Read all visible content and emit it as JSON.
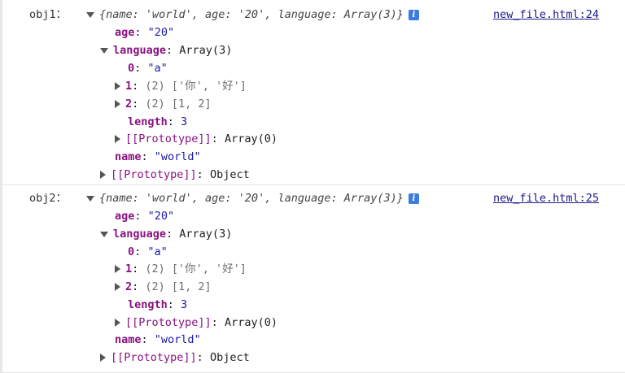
{
  "entries": [
    {
      "label": "obj1：",
      "preview": "{name: 'world', age: '20', language: Array(3)}",
      "source": "new_file.html:24",
      "age_key": "age",
      "age_val": "\"20\"",
      "lang_key": "language",
      "lang_val": "Array(3)",
      "idx0_key": "0",
      "idx0_val": "\"a\"",
      "idx1_key": "1",
      "idx1_val": "(2) ['你', '好']",
      "idx2_key": "2",
      "idx2_val": "(2) [1, 2]",
      "length_key": "length",
      "length_val": "3",
      "arr_proto": "[[Prototype]]",
      "arr_proto_val": "Array(0)",
      "name_key": "name",
      "name_val": "\"world\"",
      "obj_proto": "[[Prototype]]",
      "obj_proto_val": "Object"
    },
    {
      "label": "obj2：",
      "preview": "{name: 'world', age: '20', language: Array(3)}",
      "source": "new_file.html:25",
      "age_key": "age",
      "age_val": "\"20\"",
      "lang_key": "language",
      "lang_val": "Array(3)",
      "idx0_key": "0",
      "idx0_val": "\"a\"",
      "idx1_key": "1",
      "idx1_val": "(2) ['你', '好']",
      "idx2_key": "2",
      "idx2_val": "(2) [1, 2]",
      "length_key": "length",
      "length_val": "3",
      "arr_proto": "[[Prototype]]",
      "arr_proto_val": "Array(0)",
      "name_key": "name",
      "name_val": "\"world\"",
      "obj_proto": "[[Prototype]]",
      "obj_proto_val": "Object"
    }
  ],
  "colors": {
    "key": "#881280",
    "string": "#1a1aa6",
    "link": "#1a1a8a",
    "info": "#3b7ce0"
  },
  "icons": {
    "expanded": "triangle-down-icon",
    "collapsed": "triangle-right-icon",
    "info": "info-icon"
  }
}
